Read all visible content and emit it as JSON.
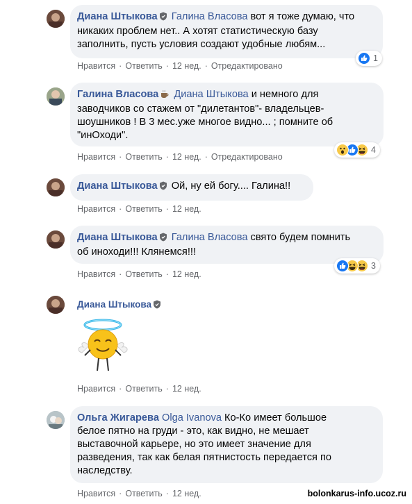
{
  "actions": {
    "like": "Нравится",
    "reply": "Ответить",
    "edited": "Отредактировано"
  },
  "comments": [
    {
      "author": "Диана Штыкова",
      "mention": "Галина Власова",
      "lines": [
        " вот я тоже думаю, что",
        "никаких проблем нет.. А хотят статистическую базу",
        "заполнить, пусть условия создают удобные любям..."
      ],
      "time": "12 нед.",
      "reactions": {
        "icons": [
          "like-icon"
        ],
        "count": "1"
      }
    },
    {
      "author": "Галина Власова",
      "mention": "Диана Штыкова",
      "lines": [
        " и немного для",
        "заводчиков со стажем от \"дилетантов\"- владельцев-",
        "шоушников ! В 3 мес.уже многое видно... ; помните об",
        "\"инОходи\"."
      ],
      "time": "12 нед.",
      "reactions": {
        "icons": [
          "wow-icon",
          "like-icon",
          "haha-icon"
        ],
        "count": "4"
      }
    },
    {
      "author": "Диана Штыкова",
      "mention": "",
      "lines": [
        "Ой, ну ей богу.... Галина!!"
      ],
      "time": "12 нед."
    },
    {
      "author": "Диана Штыкова",
      "mention": "Галина Власова",
      "lines": [
        " свято будем помнить",
        "об иноходи!!! Клянемся!!!"
      ],
      "time": "12 нед.",
      "reactions": {
        "icons": [
          "like-icon",
          "haha-icon",
          "haha-icon"
        ],
        "count": "3"
      }
    },
    {
      "author": "Диана Штыкова",
      "sticker": "angel-emoji-sticker",
      "time": "12 нед."
    },
    {
      "author": "Ольга Жигарева",
      "mention": "Olga Ivanova",
      "lines": [
        " Ко-Ко имеет большое",
        "белое пятно на груди - это, как видно, не мешает",
        "выставочной карьере, но это имеет значение для",
        "разведения, так как белая пятнистость передается по",
        "наследству."
      ],
      "time": "12 нед."
    }
  ],
  "watermark": "bolonkarus-info.ucoz.ru"
}
